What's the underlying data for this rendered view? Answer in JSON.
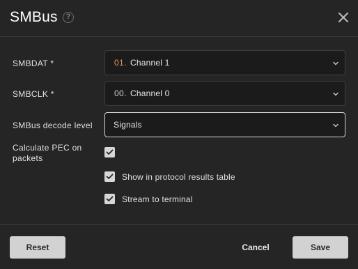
{
  "dialog": {
    "title": "SMBus",
    "help_icon": "question-circle-icon",
    "close_icon": "close-icon"
  },
  "form": {
    "smbdat": {
      "label": "SMBDAT *",
      "prefix": "01.",
      "value": "Channel 1",
      "prefix_color": "#e0965a"
    },
    "smbclk": {
      "label": "SMBCLK *",
      "prefix": "00.",
      "value": "Channel 0"
    },
    "decode_level": {
      "label": "SMBus decode level",
      "value": "Signals"
    },
    "calculate_pec": {
      "label_line1": "Calculate PEC on",
      "label_line2": "packets",
      "checked": true
    },
    "show_in_table": {
      "label": "Show in protocol results table",
      "checked": true
    },
    "stream_terminal": {
      "label": "Stream to terminal",
      "checked": true
    }
  },
  "footer": {
    "reset_label": "Reset",
    "cancel_label": "Cancel",
    "save_label": "Save"
  }
}
